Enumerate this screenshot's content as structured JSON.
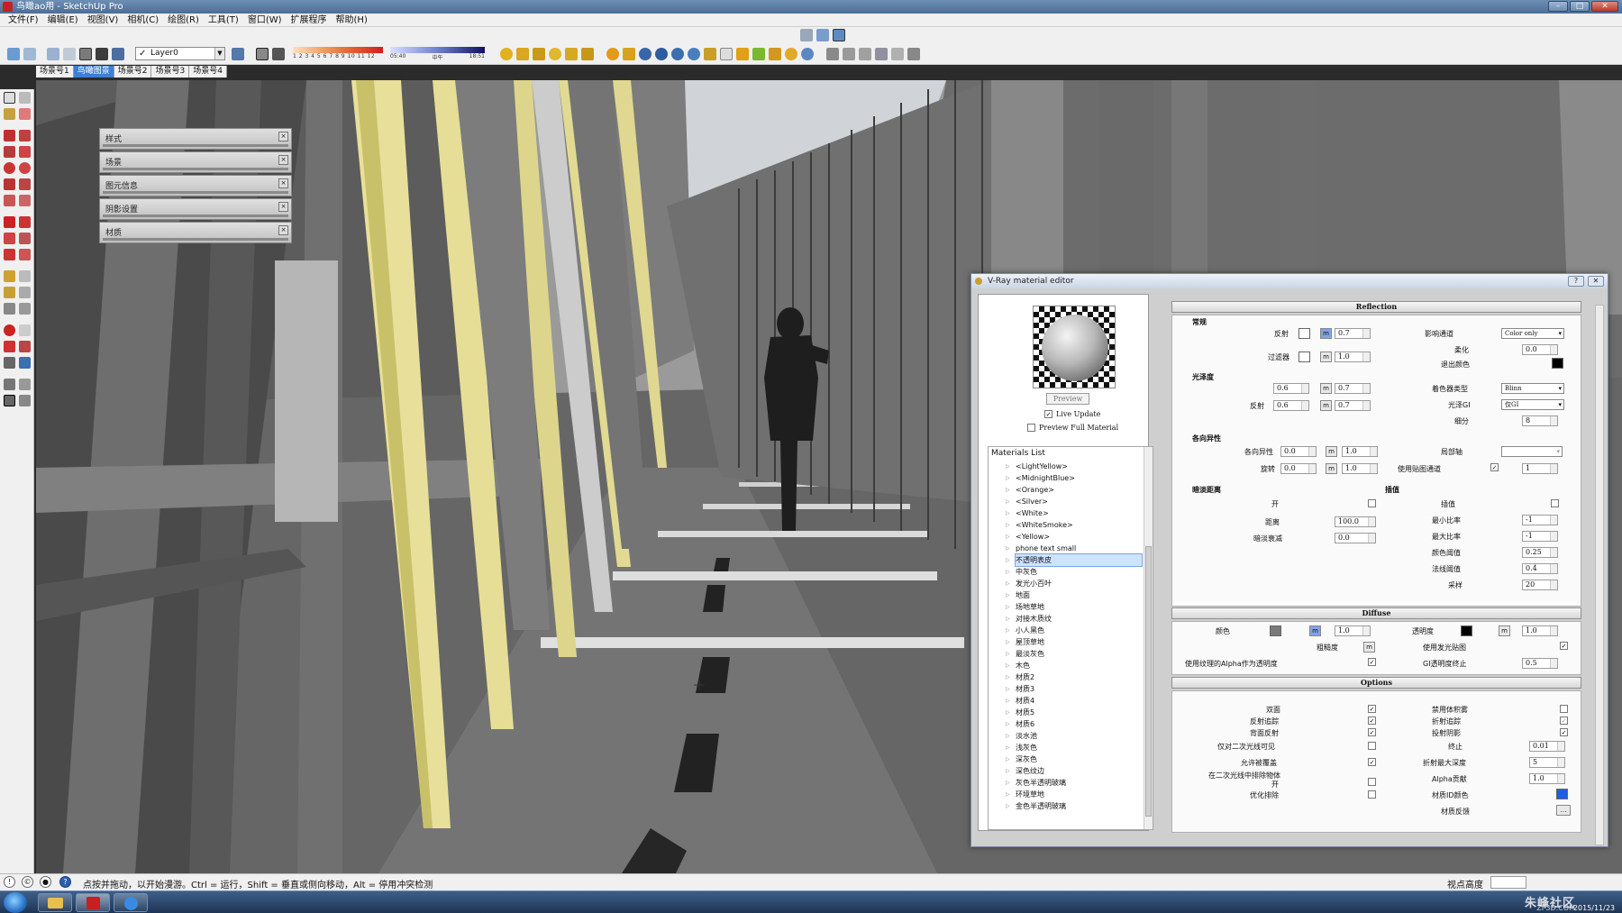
{
  "window": {
    "title": "鸟瞰ao用 - SketchUp Pro"
  },
  "menu": [
    "文件(F)",
    "编辑(E)",
    "视图(V)",
    "相机(C)",
    "绘图(R)",
    "工具(T)",
    "窗口(W)",
    "扩展程序",
    "帮助(H)"
  ],
  "toolbar": {
    "layer": "Layer0",
    "shadow_months": "1 2 3 4 5 6 7 8 9 10 11 12",
    "time_start": "05:40",
    "time_mid": "中午",
    "time_end": "18:51"
  },
  "scene_tabs": [
    {
      "label": "场景号1",
      "active": false
    },
    {
      "label": "鸟瞰图景",
      "active": true
    },
    {
      "label": "场景号2",
      "active": false
    },
    {
      "label": "场景号3",
      "active": false
    },
    {
      "label": "场景号4",
      "active": false
    }
  ],
  "trays": [
    "样式",
    "场景",
    "图元信息",
    "阴影设置",
    "材质"
  ],
  "vray": {
    "title": "V-Ray material editor",
    "preview_button": "Preview",
    "live_update": "Live Update",
    "preview_full": "Preview Full Material",
    "materials_header": "Materials List",
    "materials": [
      "<LightYellow>",
      "<MidnightBlue>",
      "<Orange>",
      "<Silver>",
      "<White>",
      "<WhiteSmoke>",
      "<Yellow>",
      "phone text small",
      "不透明表皮",
      "中灰色",
      "发光小百叶",
      "地面",
      "场地草地",
      "对接木质纹",
      "小人黑色",
      "屋顶草地",
      "最淡灰色",
      "木色",
      "材质2",
      "材质3",
      "材质4",
      "材质5",
      "材质6",
      "淡水池",
      "浅灰色",
      "深灰色",
      "深色纹边",
      "灰色半透明玻璃",
      "环境草地",
      "金色半透明玻璃"
    ],
    "selected_material": "不透明表皮",
    "reflection": {
      "section": "Reflection",
      "group_general": "常规",
      "reflect_label": "反射",
      "reflect_value": "0.7",
      "filter_label": "过滤器",
      "filter_value": "1.0",
      "affect_channels_label": "影响通道",
      "affect_channels": "Color only",
      "soften_label": "柔化",
      "soften_value": "0.0",
      "exit_color_label": "退出颜色",
      "group_gloss": "光泽度",
      "highlight_label": "高光",
      "highlight_value": "0.6",
      "highlight_map": "0.7",
      "refl_gloss_label": "反射",
      "refl_gloss_value": "0.6",
      "refl_gloss_map": "0.7",
      "brdf_label": "着色器类型",
      "brdf": "Blinn",
      "gloss_gi_label": "光泽GI",
      "gloss_gi": "仅GI",
      "subdivs_label": "细分",
      "subdivs": "8",
      "group_aniso": "各向异性",
      "aniso_label": "各向异性",
      "aniso_value": "0.0",
      "aniso_map": "1.0",
      "rotation_label": "旋转",
      "rotation_value": "0.0",
      "rotation_map": "1.0",
      "local_axis_label": "局部轴",
      "use_map_channel_label": "使用贴图通道",
      "map_channel": "1",
      "group_dim": "暗淡距离",
      "dim_on_label": "开",
      "distance_label": "距离",
      "distance_value": "100.0",
      "falloff_label": "暗淡衰减",
      "falloff_value": "0.0",
      "group_interp": "插值",
      "interp_label": "插值",
      "min_rate_label": "最小比率",
      "min_rate": "-1",
      "max_rate_label": "最大比率",
      "max_rate": "-1",
      "color_thresh_label": "颜色阈值",
      "color_thresh": "0.25",
      "normal_thresh_label": "法线阈值",
      "normal_thresh": "0.4",
      "samples_label": "采样",
      "samples": "20"
    },
    "diffuse": {
      "section": "Diffuse",
      "color_label": "颜色",
      "color_value": "1.0",
      "transparency_label": "透明度",
      "transparency_value": "1.0",
      "roughness_label": "粗糙度",
      "use_irradiance_label": "使用发光贴图",
      "use_alpha_label": "使用纹理的Alpha作为透明度",
      "gi_cutoff_label": "GI透明度终止",
      "gi_cutoff": "0.5"
    },
    "options": {
      "section": "Options",
      "double_sided": "双面",
      "trace_reflections": "反射追踪",
      "back_reflections": "背面反射",
      "secondary_rays": "仅对二次光线可见",
      "allow_override": "允许被覆盖",
      "cutoff_secondary_a": "在二次光线中排除物体",
      "cutoff_secondary_b": "开",
      "optimize_exclusion": "优化排除",
      "use_volume": "禁用体积雾",
      "trace_refractions": "折射追踪",
      "cast_shadows": "投射阴影",
      "cutoff_label": "终止",
      "cutoff": "0.01",
      "max_refr_depth_label": "折射最大深度",
      "max_refr_depth": "5",
      "alpha_contrib_label": "Alpha贡献",
      "alpha_contrib": "1.0",
      "material_id_label": "材质ID颜色",
      "material_reflect_label": "材质反馈"
    }
  },
  "status": {
    "hint": "点按并拖动，以开始漫游。Ctrl = 运行，Shift = 垂直或侧向移动，Alt = 停用冲突检测",
    "viewpoint_label": "视点高度"
  },
  "taskbar": {
    "watermark": "朱峰社区",
    "watermark_site": "ZF3D.COM",
    "date": "2015/11/23"
  },
  "colors": {
    "accent": "#3d7fd6",
    "exit_color": "#000000",
    "diffuse_color": "#7a7a7a",
    "transparency_color": "#000000",
    "material_id_color": "#1f5fe0"
  }
}
